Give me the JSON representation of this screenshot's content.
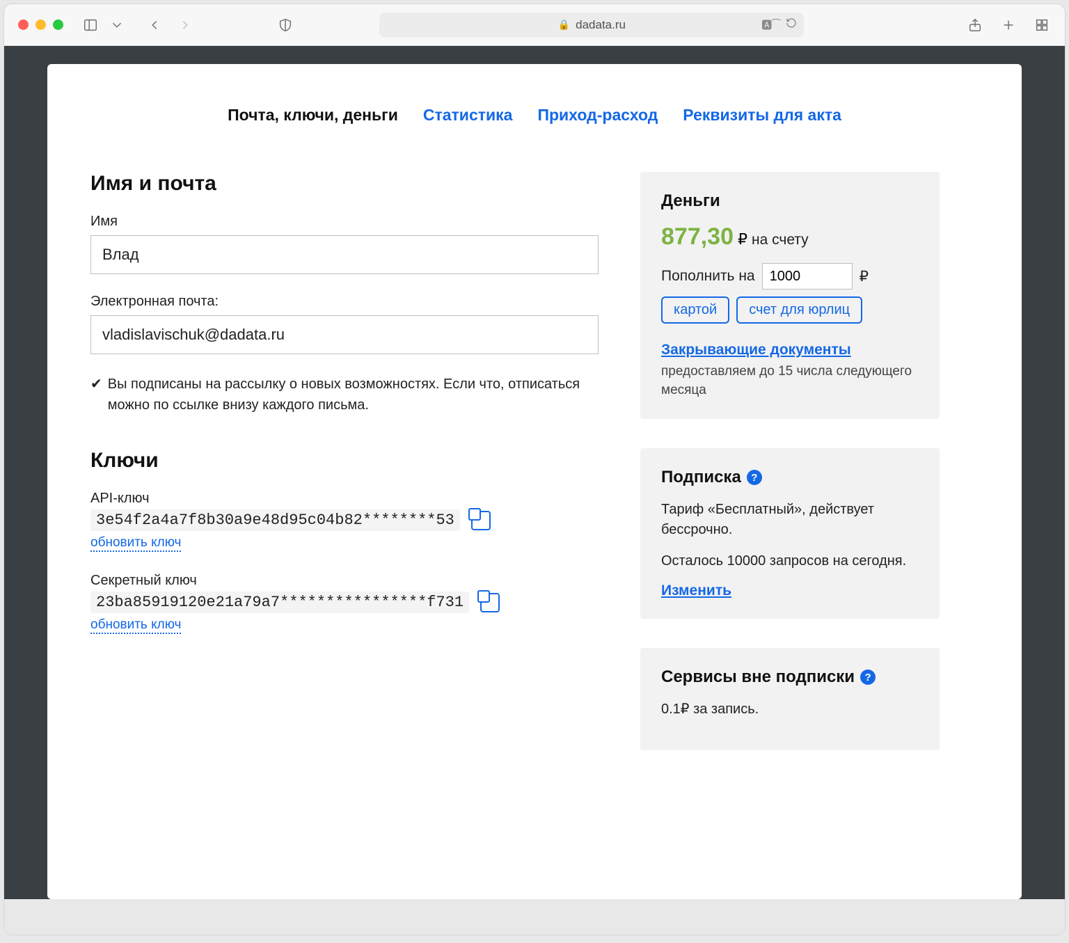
{
  "browser": {
    "url": "dadata.ru"
  },
  "tabs": {
    "active": "Почта, ключи, деньги",
    "stats": "Статистика",
    "flow": "Приход-расход",
    "requisites": "Реквизиты для акта"
  },
  "nameSection": {
    "heading": "Имя и почта",
    "nameLabel": "Имя",
    "nameValue": "Влад",
    "emailLabel": "Электронная почта:",
    "emailValue": "vladislavischuk@dadata.ru",
    "subscriptionNote": "Вы подписаны на рассылку о новых возможностях. Если что, отписаться можно по ссылке внизу каждого письма."
  },
  "keysSection": {
    "heading": "Ключи",
    "apiLabel": "API-ключ",
    "apiValue": "3e54f2a4a7f8b30a9e48d95c04b82********53",
    "secretLabel": "Секретный ключ",
    "secretValue": "23ba85919120e21a79a7****************f731",
    "refreshLabel": "обновить ключ"
  },
  "money": {
    "heading": "Деньги",
    "balance": "877,30",
    "balanceSuffix": "на счету",
    "rubleSign": "₽",
    "topupLabel": "Пополнить на",
    "topupValue": "1000",
    "byCard": "картой",
    "byInvoice": "счет для юрлиц",
    "closingDocs": "Закрывающие документы",
    "closingNote": "предоставляем до 15 числа следующего месяца"
  },
  "subscription": {
    "heading": "Подписка",
    "tariff": "Тариф «Бесплатный», действует бессрочно.",
    "remaining": "Осталось 10000 запросов на сегодня.",
    "change": "Изменить"
  },
  "extras": {
    "heading": "Сервисы вне подписки",
    "price": "0.1₽ за запись."
  }
}
